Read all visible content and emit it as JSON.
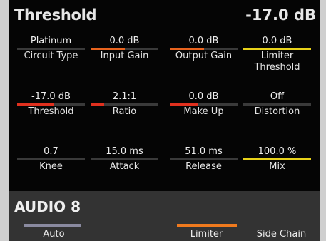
{
  "header": {
    "title": "Threshold",
    "value": "-17.0 dB"
  },
  "colors": {
    "track": "#3a3a3a",
    "orange": "#e8631e",
    "red": "#e0301e",
    "yellow": "#e8d21a"
  },
  "params": [
    {
      "label": "Circuit Type",
      "value": "Platinum",
      "level": 0,
      "fill": "none"
    },
    {
      "label": "Input Gain",
      "value": "0.0 dB",
      "level": 0.5,
      "fill": "orange"
    },
    {
      "label": "Output Gain",
      "value": "0.0 dB",
      "level": 0.5,
      "fill": "orange"
    },
    {
      "label": "Limiter Threshold",
      "value": "0.0 dB",
      "level": 1.0,
      "fill": "yellow"
    },
    {
      "label": "Threshold",
      "value": "-17.0 dB",
      "level": 0.55,
      "fill": "red"
    },
    {
      "label": "Ratio",
      "value": "2.1:1",
      "level": 0.2,
      "fill": "red"
    },
    {
      "label": "Make Up",
      "value": "0.0 dB",
      "level": 0.42,
      "fill": "red"
    },
    {
      "label": "Distortion",
      "value": "Off",
      "level": 0,
      "fill": "none"
    },
    {
      "label": "Knee",
      "value": "0.7",
      "level": 0,
      "fill": "none"
    },
    {
      "label": "Attack",
      "value": "15.0 ms",
      "level": 0,
      "fill": "none"
    },
    {
      "label": "Release",
      "value": "51.0 ms",
      "level": 0,
      "fill": "none"
    },
    {
      "label": "Mix",
      "value": "100.0 %",
      "level": 1.0,
      "fill": "yellow"
    }
  ],
  "footer": {
    "title": "AUDIO 8",
    "buttons": [
      {
        "label": "Auto",
        "active": false
      },
      {
        "label": "",
        "active": false
      },
      {
        "label": "Limiter",
        "active": true
      },
      {
        "label": "Side Chain",
        "active": false
      }
    ]
  }
}
